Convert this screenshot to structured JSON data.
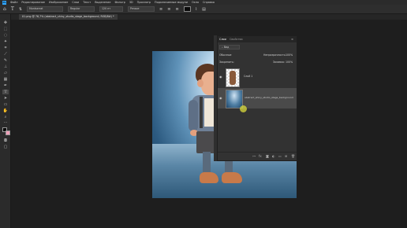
{
  "menu": {
    "app_logo": "Ps",
    "items": [
      "Файл",
      "Редактирование",
      "Изображение",
      "Слои",
      "Текст",
      "Выделение",
      "Фильтр",
      "3D",
      "Просмотр",
      "Подключаемые модули",
      "Окно",
      "Справка"
    ]
  },
  "options": {
    "font_family": "Montserrat",
    "font_style": "Regular",
    "font_size": "120 пт",
    "aa": "Резкое",
    "color_hex": "#000000"
  },
  "document": {
    "tab_title": "01.png @ 76,7% (abstract_shiny_studio_stage_background, RGB/8#) *"
  },
  "layers_panel": {
    "tab_layers": "Слои",
    "tab_properties": "Свойства",
    "filter_label": "Вид",
    "blend_mode": "Обычные",
    "opacity_label": "Непрозрачность:",
    "opacity_value": "100%",
    "lock_label": "Закрепить:",
    "fill_label": "Заливка:",
    "fill_value": "100%",
    "layers": [
      {
        "name": "Слой 1"
      },
      {
        "name": "abstract_shiny_studio_stage_background"
      }
    ]
  },
  "icons": [
    "home-icon",
    "move-tool-icon",
    "marquee-tool-icon",
    "lasso-tool-icon",
    "magic-wand-icon",
    "crop-tool-icon",
    "eyedropper-icon",
    "brush-tool-icon",
    "stamp-tool-icon",
    "eraser-tool-icon",
    "gradient-tool-icon",
    "pen-tool-icon",
    "text-tool-icon",
    "path-select-icon",
    "rectangle-tool-icon",
    "hand-tool-icon",
    "zoom-tool-icon",
    "eye-icon",
    "link-icon",
    "fx-icon",
    "mask-icon",
    "adjustment-icon",
    "folder-icon",
    "new-layer-icon",
    "trash-icon"
  ],
  "colors": {
    "accent": "#31a8ff",
    "foreground_color": "#000000",
    "background_color": "#ffffff"
  }
}
